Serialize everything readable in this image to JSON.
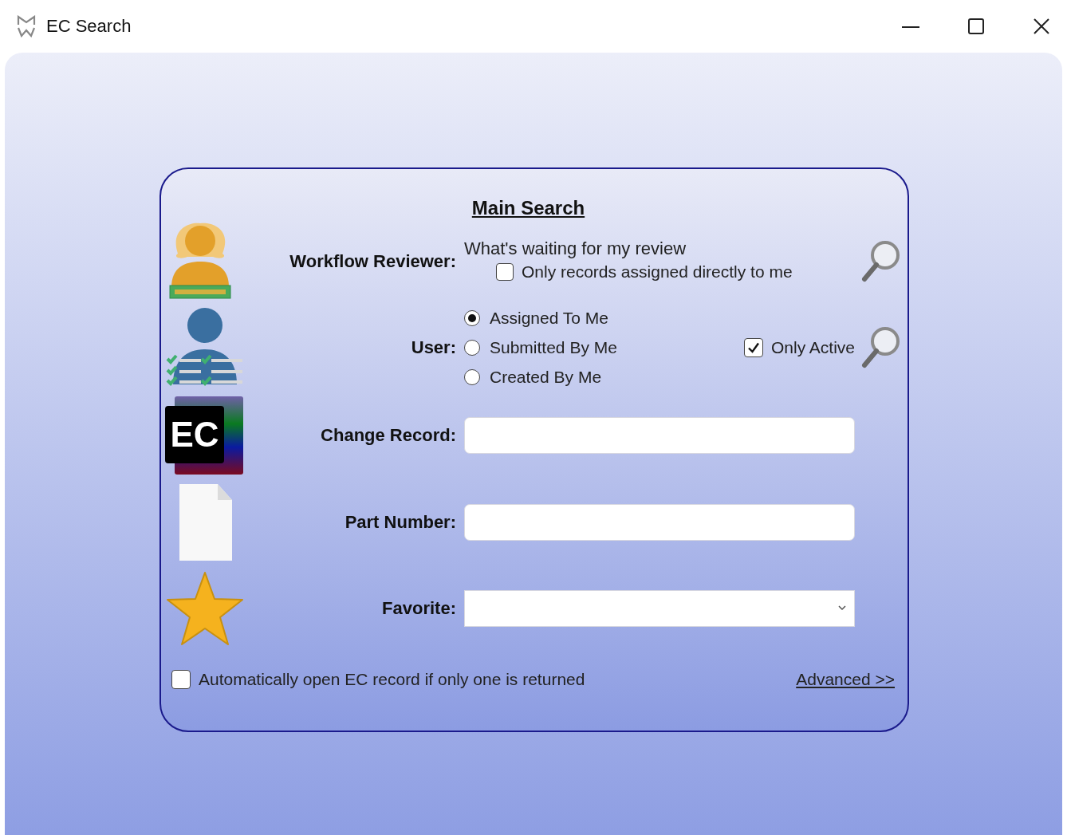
{
  "window": {
    "title": "EC Search"
  },
  "main_search": {
    "title": "Main Search",
    "workflow_reviewer": {
      "label": "Workflow Reviewer:",
      "text": "What's waiting for my review",
      "checkbox": {
        "label": "Only records assigned directly to me",
        "checked": false
      }
    },
    "user": {
      "label": "User:",
      "options": [
        {
          "label": "Assigned To Me",
          "selected": true
        },
        {
          "label": "Submitted By Me",
          "selected": false
        },
        {
          "label": "Created By Me",
          "selected": false
        }
      ],
      "only_active": {
        "label": "Only Active",
        "checked": true
      }
    },
    "change_record": {
      "label": "Change Record:",
      "logo_text": "EC"
    },
    "part_number": {
      "label": "Part Number:"
    },
    "favorite": {
      "label": "Favorite:"
    },
    "auto_open": {
      "label": "Automatically open EC record if only one is returned",
      "checked": false
    },
    "advanced_link": "Advanced >>"
  }
}
